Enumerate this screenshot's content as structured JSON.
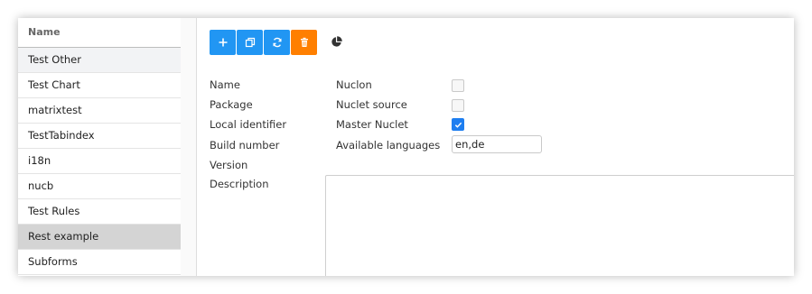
{
  "sidebar": {
    "header": "Name",
    "items": [
      {
        "label": "Test Other"
      },
      {
        "label": "Test Chart"
      },
      {
        "label": "matrixtest"
      },
      {
        "label": "TestTabindex"
      },
      {
        "label": "i18n"
      },
      {
        "label": "nucb"
      },
      {
        "label": "Test Rules"
      },
      {
        "label": "Rest example"
      },
      {
        "label": "Subforms"
      }
    ],
    "selected": "Rest example"
  },
  "toolbar": {
    "buttons": [
      {
        "icon": "plus-icon",
        "color": "#2196f3"
      },
      {
        "icon": "copy-icon",
        "color": "#2196f3"
      },
      {
        "icon": "refresh-icon",
        "color": "#2196f3"
      },
      {
        "icon": "trash-icon",
        "color": "#ff7f00"
      }
    ],
    "extra_icon": "pie-chart-icon"
  },
  "form": {
    "labels": {
      "name": "Name",
      "package": "Package",
      "local_identifier": "Local identifier",
      "build_number": "Build number",
      "version": "Version",
      "description": "Description",
      "nuclon": "Nuclon",
      "nuclet_source": "Nuclet source",
      "master_nuclet": "Master Nuclet",
      "available_languages": "Available languages"
    },
    "nuclon_checked": false,
    "nuclet_source_checked": false,
    "master_nuclet_checked": true,
    "available_languages_value": "en,de"
  }
}
